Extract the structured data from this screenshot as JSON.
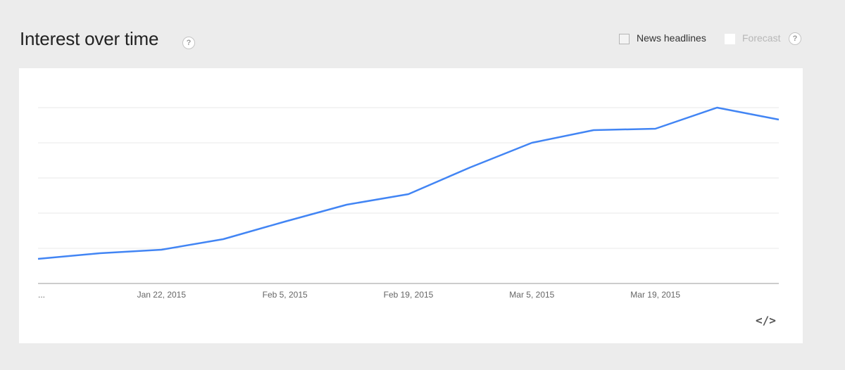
{
  "header": {
    "title": "Interest over time",
    "help_label": "?",
    "news_label": "News headlines",
    "forecast_label": "Forecast",
    "forecast_help_label": "?"
  },
  "embed_label": "</>",
  "colors": {
    "line": "#4285f4",
    "gridline": "#e8e8e8",
    "axis": "#999999",
    "background": "#ececec",
    "card": "#ffffff"
  },
  "chart_data": {
    "type": "line",
    "title": "Interest over time",
    "x_tick_labels": [
      "...",
      "Jan 22, 2015",
      "Feb 5, 2015",
      "Feb 19, 2015",
      "Mar 5, 2015",
      "Mar 19, 2015"
    ],
    "x": [
      "2015-01-08",
      "2015-01-15",
      "2015-01-22",
      "2015-01-29",
      "2015-02-05",
      "2015-02-12",
      "2015-02-19",
      "2015-02-26",
      "2015-03-05",
      "2015-03-12",
      "2015-03-19",
      "2015-03-26",
      "2015-04-02"
    ],
    "series": [
      {
        "values": [
          35,
          43,
          48,
          63,
          88,
          112,
          127,
          165,
          200,
          218,
          220,
          250,
          233
        ]
      }
    ],
    "ylim": [
      0,
      250
    ],
    "y_gridlines": [
      50,
      100,
      150,
      200,
      250
    ],
    "grid": true,
    "legend": "none"
  }
}
